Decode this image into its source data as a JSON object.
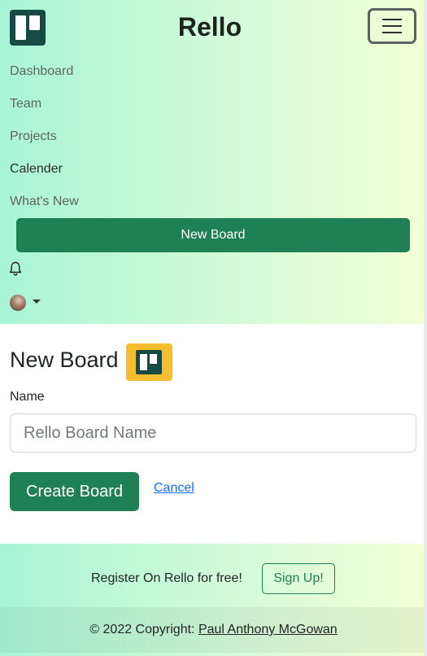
{
  "navbar": {
    "brand": "Rello",
    "links": [
      {
        "label": "Dashboard",
        "active": false
      },
      {
        "label": "Team",
        "active": false
      },
      {
        "label": "Projects",
        "active": false
      },
      {
        "label": "Calender",
        "active": true
      },
      {
        "label": "What's New",
        "active": false
      }
    ],
    "new_board_label": "New Board",
    "toggler_icon": "hamburger-icon",
    "bell_icon": "bell-icon"
  },
  "form": {
    "title": "New Board",
    "name_label": "Name",
    "name_placeholder": "Rello Board Name",
    "name_value": "",
    "submit_label": "Create Board",
    "cancel_label": "Cancel"
  },
  "footer": {
    "register_text": "Register On Rello for free!",
    "signup_label": "Sign Up!",
    "copyright_prefix": "© 2022 Copyright:",
    "copyright_author": "Paul Anthony McGowan"
  },
  "colors": {
    "primary": "#1f7f55",
    "brand_dark": "#174a42",
    "badge": "#f6be2e",
    "link": "#0d6efd"
  }
}
